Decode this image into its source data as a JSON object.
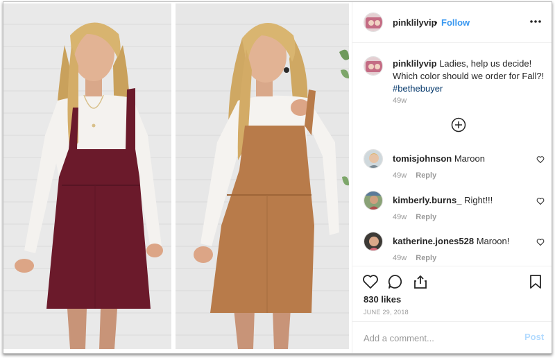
{
  "post": {
    "username": "pinklilyvip",
    "follow_separator": "•",
    "follow_label": "Follow",
    "more_label": "•••"
  },
  "caption": {
    "username": "pinklilyvip",
    "text": "Ladies, help us decide! Which color should we order for Fall?!",
    "hashtag": "#bethebuyer",
    "time": "49w"
  },
  "load_more_icon": "plus-circle-icon",
  "comments": [
    {
      "username": "tomisjohnson",
      "text": "Maroon",
      "time": "49w",
      "reply_label": "Reply"
    },
    {
      "username": "kimberly.burns_",
      "text": "Right!!!",
      "time": "49w",
      "reply_label": "Reply"
    },
    {
      "username": "katherine.jones528",
      "text": "Maroon!",
      "time": "49w",
      "reply_label": "Reply"
    }
  ],
  "actions": {
    "icons": [
      "heart-icon",
      "comment-bubble-icon",
      "share-icon",
      "bookmark-icon"
    ],
    "likes": "830 likes",
    "date": "JUNE 29, 2018"
  },
  "add_comment": {
    "placeholder": "Add a comment...",
    "post_label": "Post"
  },
  "colors": {
    "link_blue": "#3897f0",
    "hashtag_blue": "#003569",
    "muted_gray": "#999999",
    "post_disabled": "#b3dbff",
    "maroon_dress": "#6b1a2b",
    "tan_dress": "#b87b4a"
  }
}
